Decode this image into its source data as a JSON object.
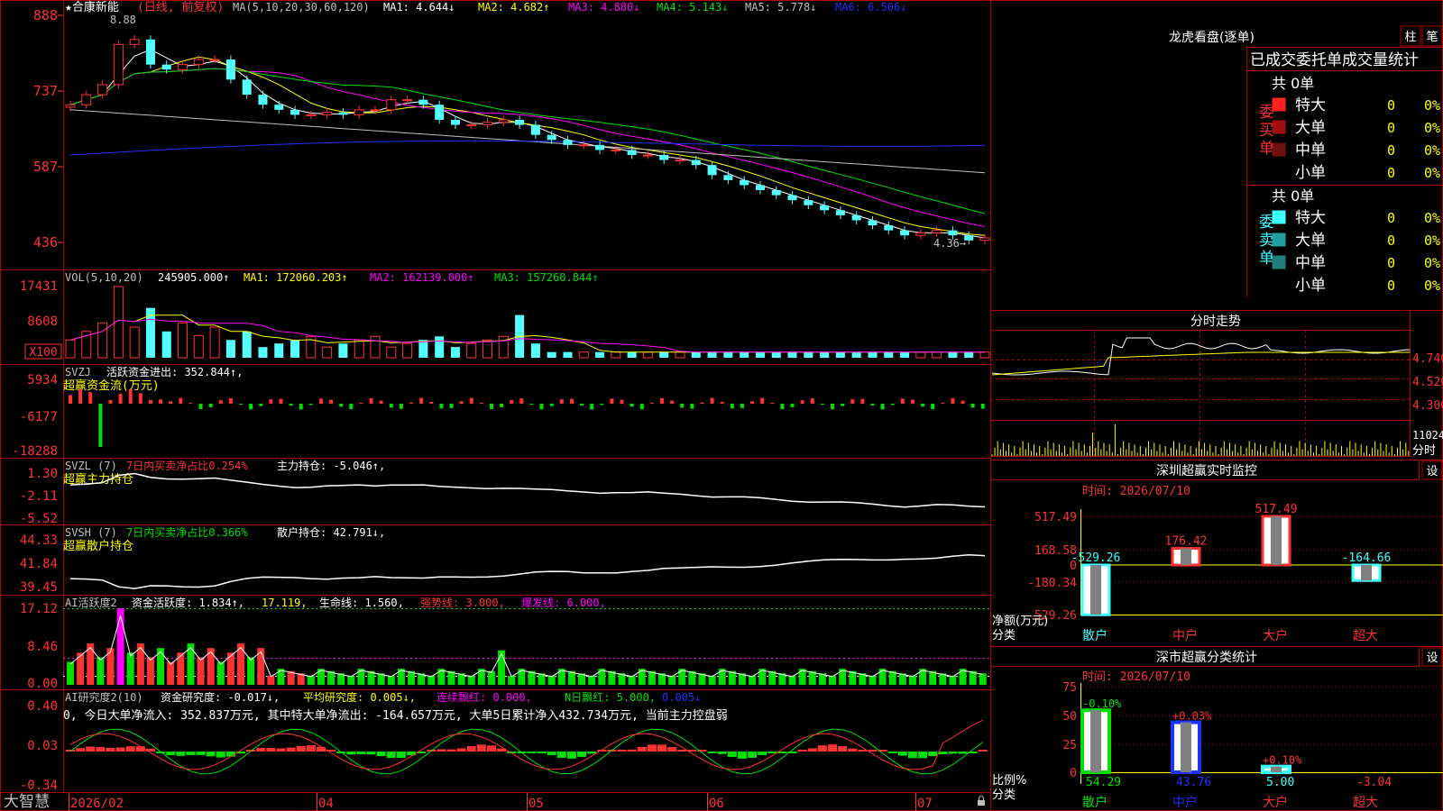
{
  "colors": {
    "up": "#ff3232",
    "down": "#54ffff",
    "grid": "#b00000",
    "text": "#c0c0c0",
    "ma1": "#ffffff",
    "ma2": "#ffff00",
    "ma3": "#ff00ff",
    "ma4": "#00e000",
    "ma5": "#c0c0c0",
    "ma6": "#2030ff"
  },
  "price_panel": {
    "title": "★合康新能",
    "period": "(日线, 前复权)",
    "ma_label": "MA(5,10,20,30,60,120)",
    "ma": [
      {
        "label": "MA1: 4.644↓"
      },
      {
        "label": "MA2: 4.682↑"
      },
      {
        "label": "MA3: 4.880↓"
      },
      {
        "label": "MA4: 5.143↓"
      },
      {
        "label": "MA5: 5.778↓"
      },
      {
        "label": "MA6: 6.506↓"
      }
    ],
    "yticks": [
      "888",
      "737",
      "587",
      "436"
    ],
    "high_marker": "8.88",
    "low_marker": "4.36→"
  },
  "vol_panel": {
    "title": "VOL(5,10,20)",
    "value": "245905.000↑",
    "ma1": "MA1: 172060.203↑",
    "ma2": "MA2: 162139.000↑",
    "ma3": "MA3: 157260.844↑",
    "yticks": [
      "17431",
      "8608",
      "X100"
    ]
  },
  "svzj_panel": {
    "title": "SVZJ",
    "line": "活跃资金进出: 352.844↑,",
    "sub": "超赢资金流(万元)",
    "yticks": [
      "5934",
      "-6177",
      "-18288"
    ]
  },
  "svzl_panel": {
    "title": "SVZL (7)",
    "ratio": "7日内买卖净占比0.254%",
    "hold": "主力持仓: -5.046↑,",
    "sub": "超赢主力持仓",
    "yticks": [
      "1.30",
      "-2.11",
      "-5.52"
    ]
  },
  "svsh_panel": {
    "title": "SVSH (7)",
    "ratio": "7日内买卖净占比0.366%",
    "hold": "散户持仓: 42.791↓,",
    "sub": "超赢散户持仓",
    "yticks": [
      "44.33",
      "41.84",
      "39.45"
    ]
  },
  "ai1_panel": {
    "title": "AI活跃度2",
    "v1": "资金活跃度: 1.834↑,",
    "v2": "17.119,",
    "v3": "生命线: 1.560,",
    "v4": "强势线: 3.000,",
    "v5": "爆发线: 6.000,",
    "yticks": [
      "17.12",
      "8.46",
      "0.00"
    ]
  },
  "ai2_panel": {
    "title": "AI研究度2(10)",
    "v1": "资金研究度: -0.017↓,",
    "v2": "平均研究度: 0.005↓,",
    "v3": "连续飘红: 0.000,",
    "v4": "N日飘红: 5.000,",
    "v5": "0.005↓",
    "desc": "0, 今日大单净流入: 352.837万元, 其中特大单净流出: -164.657万元, 大单5日累计净入432.734万元, 当前主力控盘弱",
    "yticks": [
      "0.40",
      "0.03",
      "-0.34"
    ]
  },
  "xaxis": {
    "labels": [
      "2026/02",
      "04",
      "05",
      "06",
      "07"
    ]
  },
  "brand": "大智慧",
  "lhb": {
    "title": "龙虎看盘(逐单)",
    "tab1": "柱",
    "tab2": "笔",
    "header": "已成交委托单成交量统计",
    "buy_label": "委买单",
    "sell_label": "委卖单",
    "buy_total": "共 0单",
    "sell_total": "共 0单",
    "buy_rows": [
      {
        "name": "特大",
        "count": "0",
        "pct": "0%",
        "color": "#ff2020"
      },
      {
        "name": "大单",
        "count": "0",
        "pct": "0%",
        "color": "#a01010"
      },
      {
        "name": "中单",
        "count": "0",
        "pct": "0%",
        "color": "#701010"
      },
      {
        "name": "小单",
        "count": "0",
        "pct": "0%",
        "color": "#000000"
      }
    ],
    "sell_rows": [
      {
        "name": "特大",
        "count": "0",
        "pct": "0%",
        "color": "#40ffff"
      },
      {
        "name": "大单",
        "count": "0",
        "pct": "0%",
        "color": "#20a0a0"
      },
      {
        "name": "中单",
        "count": "0",
        "pct": "0%",
        "color": "#208080"
      },
      {
        "name": "小单",
        "count": "0",
        "pct": "0%",
        "color": "#000000"
      }
    ]
  },
  "intraday": {
    "title": "分时走势",
    "yticks": [
      "4.740",
      "4.520",
      "4.300"
    ],
    "vol_tick": "11024",
    "vol_label": "分时"
  },
  "monitor": {
    "title": "深圳超赢实时监控",
    "settings": "设",
    "time": "时间: 2026/07/10",
    "yticks": [
      "517.49",
      "168.58",
      "0",
      "-180.34",
      "-529.26"
    ],
    "ylabel": "净额(万元)",
    "xlabel": "分类",
    "categories": [
      "散户",
      "中户",
      "大户",
      "超大"
    ],
    "values": [
      -529.26,
      176.42,
      517.49,
      -164.66
    ],
    "value_labels": [
      "-529.26",
      "176.42",
      "517.49",
      "-164.66"
    ]
  },
  "classify": {
    "title": "深市超赢分类统计",
    "settings": "设",
    "time": "时间: 2026/07/10",
    "yticks": [
      "75",
      "50",
      "25",
      "0"
    ],
    "ylabel": "比例%",
    "xlabel": "分类",
    "categories": [
      "散户",
      "中户",
      "大户",
      "超大"
    ],
    "values": [
      54.29,
      43.76,
      5.0,
      -3.04
    ],
    "value_labels": [
      "54.29",
      "43.76",
      "5.00",
      "-3.04"
    ],
    "change_labels": [
      "-0.10%",
      "+0.03%",
      "+0.10%",
      ""
    ]
  },
  "chart_data": [
    {
      "type": "candlestick",
      "title": "★合康新能",
      "subtitle": "(日线, 前复权)",
      "ylim": [
        4.36,
        8.88
      ],
      "x": [
        "2026/02",
        "04",
        "05",
        "06",
        "07"
      ],
      "series": [
        {
          "name": "MA1",
          "last": 4.644
        },
        {
          "name": "MA2",
          "last": 4.682
        },
        {
          "name": "MA3",
          "last": 4.88
        },
        {
          "name": "MA4",
          "last": 5.143
        },
        {
          "name": "MA5",
          "last": 5.778
        },
        {
          "name": "MA6",
          "last": 6.506
        }
      ],
      "close_path": [
        7.1,
        7.3,
        7.5,
        8.3,
        8.4,
        7.9,
        7.8,
        7.9,
        8.0,
        8.0,
        7.6,
        7.3,
        7.1,
        7.0,
        6.9,
        6.9,
        6.95,
        6.9,
        7.0,
        7.0,
        7.2,
        7.2,
        7.1,
        6.8,
        6.7,
        6.7,
        6.75,
        6.8,
        6.7,
        6.5,
        6.4,
        6.3,
        6.3,
        6.2,
        6.2,
        6.1,
        6.1,
        6.0,
        6.0,
        5.9,
        5.7,
        5.6,
        5.5,
        5.4,
        5.3,
        5.2,
        5.1,
        5.0,
        4.9,
        4.8,
        4.7,
        4.6,
        4.5,
        4.55,
        4.6,
        4.5,
        4.4,
        4.45
      ]
    },
    {
      "type": "bar",
      "title": "VOL(5,10,20)",
      "ylim": [
        0,
        17431
      ],
      "value_last": 245905.0
    },
    {
      "type": "bar",
      "title": "深圳超赢实时监控",
      "categories": [
        "散户",
        "中户",
        "大户",
        "超大"
      ],
      "values": [
        -529.26,
        176.42,
        517.49,
        -164.66
      ],
      "ylim": [
        -529.26,
        517.49
      ]
    },
    {
      "type": "bar",
      "title": "深市超赢分类统计",
      "categories": [
        "散户",
        "中户",
        "大户",
        "超大"
      ],
      "values": [
        54.29,
        43.76,
        5.0,
        -3.04
      ],
      "ylim": [
        0,
        75
      ]
    }
  ]
}
